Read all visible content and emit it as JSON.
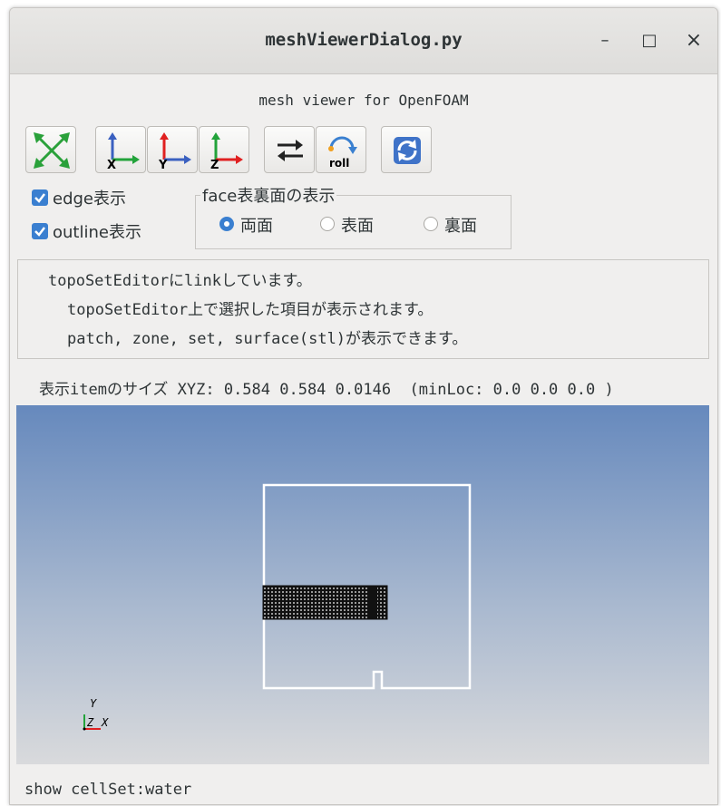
{
  "window": {
    "title": "meshViewerDialog.py",
    "minimize": "–",
    "maximize": "□",
    "close": "×"
  },
  "subtitle": "mesh viewer for OpenFOAM",
  "toolbar": {
    "fit_icon": "fit-all-icon",
    "view_x_icon": "view-x-axis-icon",
    "view_y_icon": "view-y-axis-icon",
    "view_z_icon": "view-z-axis-icon",
    "reverse_icon": "reverse-view-icon",
    "roll_label": "roll",
    "refresh_icon": "refresh-icon",
    "x_label": "X",
    "y_label": "Y",
    "z_label": "Z"
  },
  "options": {
    "edge_label": "edge表示",
    "edge_checked": true,
    "outline_label": "outline表示",
    "outline_checked": true
  },
  "face_group": {
    "title": "face表裏面の表示",
    "options": [
      "両面",
      "表面",
      "裏面"
    ],
    "selected": "両面"
  },
  "info": {
    "line1": "topoSetEditorにlinkしています。",
    "line2": "topoSetEditor上で選択した項目が表示されます。",
    "line3": "patch, zone, set, surface(stl)が表示できます。"
  },
  "size_text": "表示itemのサイズ XYZ: 0.584 0.584 0.0146  (minLoc: 0.0 0.0 0.0 )",
  "axes": {
    "y": "Y",
    "z": "Z",
    "x": "X"
  },
  "status": "show cellSet:water",
  "colors": {
    "accent": "#3a7fd0",
    "viewport_top": "#6689bd",
    "viewport_bottom": "#d9dadc"
  }
}
